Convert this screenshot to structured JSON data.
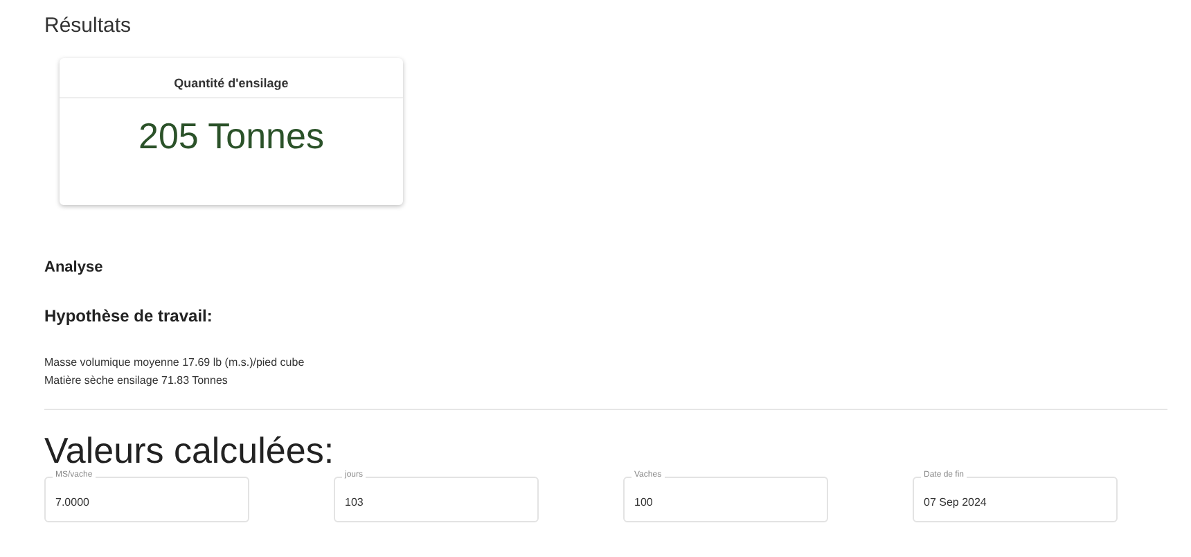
{
  "results": {
    "title": "Résultats",
    "card": {
      "title": "Quantité d'ensilage",
      "value": "205 Tonnes"
    }
  },
  "analysis": {
    "title": "Analyse",
    "subtitle": "Hypothèse de travail:",
    "lines": [
      "Masse volumique moyenne 17.69 lb (m.s.)/pied cube",
      "Matière sèche ensilage 71.83 Tonnes"
    ]
  },
  "computed": {
    "title": "Valeurs calculées:",
    "fields": [
      {
        "label": "MS/vache",
        "value": "7.0000"
      },
      {
        "label": "jours",
        "value": "103"
      },
      {
        "label": "Vaches",
        "value": "100"
      },
      {
        "label": "Date de fin",
        "value": "07 Sep 2024"
      }
    ]
  }
}
